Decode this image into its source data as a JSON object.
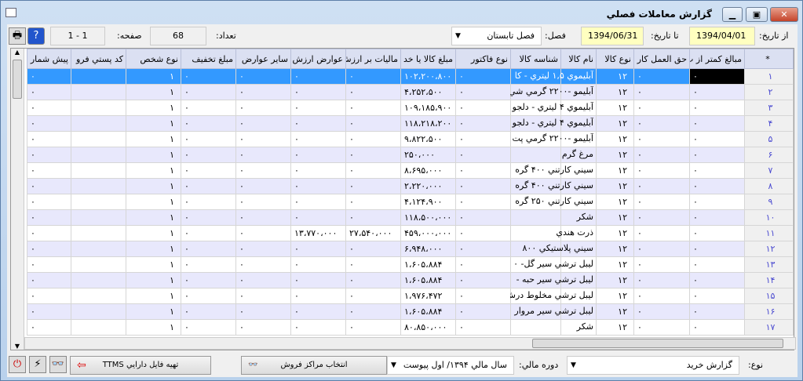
{
  "window": {
    "title": "گزارش معاملات فصلي"
  },
  "toolbar": {
    "from_label": "از تاريخ:",
    "from_value": "1394/04/01",
    "to_label": "تا تاريخ:",
    "to_value": "1394/06/31",
    "season_label": "فصل:",
    "season_value": "فصل تابستان",
    "count_label": "تعداد:",
    "count_value": "68",
    "page_label": "صفحه:",
    "page_value": "1 - 1"
  },
  "columns": [
    "*",
    "مبالغ کمتر از پ",
    "حق العمل کار",
    "نوع کالا",
    "نام کالا",
    "شناسه کالا",
    "نوع فاکتور",
    "مبلغ کالا يا خد",
    "ماليات بر ارزش",
    "عوارض ارزش",
    "ساير عوارض",
    "مبلغ تخفيف",
    "نوع شخص",
    "کد پستي فرو",
    "پيش شمار"
  ],
  "rows": [
    [
      "۱",
      "۰",
      "۰",
      "۱۲",
      "آبليموي ۱,۵ ليتري - كا",
      "",
      "۰",
      "۱۰۲،۲۰۰،۸۰۰",
      "۰",
      "۰",
      "۰",
      "۰",
      "۱",
      "",
      "۰"
    ],
    [
      "۲",
      "۰",
      "۰",
      "۱۲",
      "آبليمو -۲۲۰۰ گرمي شي",
      "",
      "۰",
      "۴،۲۵۲،۵۰۰",
      "۰",
      "۰",
      "۰",
      "۰",
      "۱",
      "",
      "۰"
    ],
    [
      "۳",
      "۰",
      "۰",
      "۱۲",
      "آبليموي ۴ ليتري - دلجو",
      "",
      "۰",
      "۱۰۹،۱۸۵،۹۰۰",
      "۰",
      "۰",
      "۰",
      "۰",
      "۱",
      "",
      "۰"
    ],
    [
      "۴",
      "۰",
      "۰",
      "۱۲",
      "آبليموي ۴ ليتري - دلجو",
      "",
      "۰",
      "۱۱۸،۲۱۸،۲۰۰",
      "۰",
      "۰",
      "۰",
      "۰",
      "۱",
      "",
      "۰"
    ],
    [
      "۵",
      "۰",
      "۰",
      "۱۲",
      "آبليمو -۲۲۰۰ گرمي پت ر",
      "",
      "۰",
      "۹،۸۲۲،۵۰۰",
      "۰",
      "۰",
      "۰",
      "۰",
      "۱",
      "",
      "۰"
    ],
    [
      "۶",
      "۰",
      "۰",
      "۱۲",
      "مرغ گرم",
      "",
      "۰",
      "۲۵۰،۰۰۰",
      "۰",
      "۰",
      "۰",
      "۰",
      "۱",
      "",
      "۰"
    ],
    [
      "۷",
      "۰",
      "۰",
      "۱۲",
      "سيني كارتني ۴۰۰ گره",
      "",
      "۰",
      "۸،۶۹۵،۰۰۰",
      "۰",
      "۰",
      "۰",
      "۰",
      "۱",
      "",
      "۰"
    ],
    [
      "۸",
      "۰",
      "۰",
      "۱۲",
      "سيني كارتني ۴۰۰ گره",
      "",
      "۰",
      "۲،۲۲۰،۰۰۰",
      "۰",
      "۰",
      "۰",
      "۰",
      "۱",
      "",
      "۰"
    ],
    [
      "۹",
      "۰",
      "۰",
      "۱۲",
      "سيني كارتني ۲۵۰ گره",
      "",
      "۰",
      "۴،۱۲۴،۹۰۰",
      "۰",
      "۰",
      "۰",
      "۰",
      "۱",
      "",
      "۰"
    ],
    [
      "۱۰",
      "۰",
      "۰",
      "۱۲",
      "شكر",
      "",
      "۰",
      "۱۱۸،۵۰۰،۰۰۰",
      "۰",
      "۰",
      "۰",
      "۰",
      "۱",
      "",
      "۰"
    ],
    [
      "۱۱",
      "۰",
      "۰",
      "۱۲",
      "ذرت هندي",
      "",
      "۰",
      "۴۵۹،۰۰۰،۰۰۰",
      "۲۷،۵۴۰،۰۰۰",
      "۱۳،۷۷۰،۰۰۰",
      "۰",
      "۰",
      "۱",
      "",
      "۰"
    ],
    [
      "۱۲",
      "۰",
      "۰",
      "۱۲",
      "سيني پلاستيكي ۸۰۰",
      "",
      "۰",
      "۶،۹۴۸،۰۰۰",
      "۰",
      "۰",
      "۰",
      "۰",
      "۱",
      "",
      "۰"
    ],
    [
      "۱۳",
      "۰",
      "۰",
      "۱۲",
      "ليبل ترشي سير گل- ۰",
      "",
      "۰",
      "۱،۶۰۵،۸۸۴",
      "۰",
      "۰",
      "۰",
      "۰",
      "۱",
      "",
      "۰"
    ],
    [
      "۱۴",
      "۰",
      "۰",
      "۱۲",
      "ليبل ترشي سير حبه -",
      "",
      "۰",
      "۱،۶۰۵،۸۸۴",
      "۰",
      "۰",
      "۰",
      "۰",
      "۱",
      "",
      "۰"
    ],
    [
      "۱۵",
      "۰",
      "۰",
      "۱۲",
      "ليبل ترشي مخلوط درش",
      "",
      "۰",
      "۱،۹۷۶،۴۷۲",
      "۰",
      "۰",
      "۰",
      "۰",
      "۱",
      "",
      "۰"
    ],
    [
      "۱۶",
      "۰",
      "۰",
      "۱۲",
      "ليبل ترشي سير مروار",
      "",
      "۰",
      "۱،۶۰۵،۸۸۴",
      "۰",
      "۰",
      "۰",
      "۰",
      "۱",
      "",
      "۰"
    ],
    [
      "۱۷",
      "۰",
      "۰",
      "۱۲",
      "شكر",
      "",
      "۰",
      "۸۰،۸۵۰،۰۰۰",
      "۰",
      "۰",
      "۰",
      "۰",
      "۱",
      "",
      "۰"
    ]
  ],
  "footer": {
    "type_label": "نوع:",
    "type_value": "گزارش خريد",
    "period_label": "دوره مالي:",
    "period_value": "سال مالي ۱۳۹۴/ اول پيوست",
    "select_centers": "انتخاب مراكز فروش",
    "ttms": "تهيه فايل دارايي TTMS"
  },
  "colors": {
    "selection": "#3399ff",
    "header": "#dbe0f2",
    "alt_row": "#e8e8fc",
    "date_field": "#ffffc0"
  }
}
